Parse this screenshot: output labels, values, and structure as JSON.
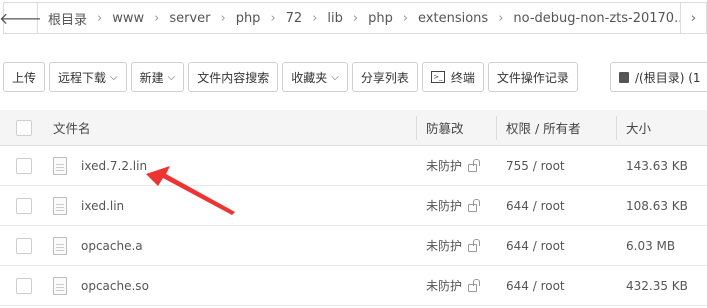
{
  "breadcrumb": {
    "back_icon": "arrow-left-icon",
    "items": [
      {
        "label": "根目录"
      },
      {
        "label": "www"
      },
      {
        "label": "server"
      },
      {
        "label": "php"
      },
      {
        "label": "72"
      },
      {
        "label": "lib"
      },
      {
        "label": "php"
      },
      {
        "label": "extensions"
      },
      {
        "label": "no-debug-non-zts-20170..."
      }
    ],
    "more_icon": "chevron-right-icon"
  },
  "toolbar": {
    "upload": "上传",
    "remote_download": "远程下载",
    "new": "新建",
    "content_search": "文件内容搜索",
    "favorites": "收藏夹",
    "share_list": "分享列表",
    "terminal": "终端",
    "terminal_icon_text": ">_",
    "file_log": "文件操作记录",
    "disk": "/(根目录) (1"
  },
  "table": {
    "headers": {
      "name": "文件名",
      "protect": "防篡改",
      "perm": "权限 / 所有者",
      "size": "大小"
    },
    "rows": [
      {
        "name": "ixed.7.2.lin",
        "protect": "未防护",
        "perm": "755 / root",
        "size": "143.63 KB"
      },
      {
        "name": "ixed.lin",
        "protect": "未防护",
        "perm": "644 / root",
        "size": "108.63 KB"
      },
      {
        "name": "opcache.a",
        "protect": "未防护",
        "perm": "644 / root",
        "size": "6.03 MB"
      },
      {
        "name": "opcache.so",
        "protect": "未防护",
        "perm": "644 / root",
        "size": "432.35 KB"
      }
    ]
  },
  "annotation": {
    "color": "#ee3333",
    "icon": "red-arrow-annotation"
  }
}
